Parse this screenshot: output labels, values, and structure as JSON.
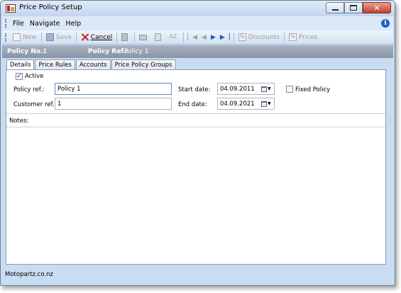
{
  "window": {
    "title": "Price Policy Setup"
  },
  "menu": {
    "items": [
      "File",
      "Navigate",
      "Help"
    ]
  },
  "toolbar": {
    "new_label": "New",
    "save_label": "Save",
    "cancel_label": "Cancel",
    "discounts_label": "Discounts",
    "prices_label": "Prices",
    "sort_glyph": "AZ"
  },
  "policy": {
    "no_label": "Policy No.:",
    "no_value": "1",
    "ref_label": "Policy Ref.:",
    "ref_value": "Policy 1"
  },
  "tabs": [
    {
      "label": "Details",
      "active": true
    },
    {
      "label": "Price Rules",
      "active": false
    },
    {
      "label": "Accounts",
      "active": false
    },
    {
      "label": "Price Policy Groups",
      "active": false
    }
  ],
  "details": {
    "active_label": "Active",
    "active_checked": true,
    "policy_ref_label": "Policy ref.:",
    "policy_ref_value": "Policy 1",
    "customer_ref_label": "Customer ref.:",
    "customer_ref_value": "1",
    "start_date_label": "Start date:",
    "start_date_value": "04.09.2011",
    "end_date_label": "End date:",
    "end_date_value": "04.09.2021",
    "fixed_policy_label": "Fixed Policy",
    "fixed_policy_checked": false,
    "notes_label": "Notes:"
  },
  "status": {
    "text": "Motopartz.co.nz"
  },
  "icons": {
    "info": "info-icon",
    "checkmark": "✓",
    "close": "✕"
  },
  "colors": {
    "window_frame": "#c9dcf1",
    "policy_bar": "#8895a6",
    "close_button": "#c2412d",
    "cancel_icon": "#d11a1a",
    "nav_active": "#1f57b5"
  }
}
